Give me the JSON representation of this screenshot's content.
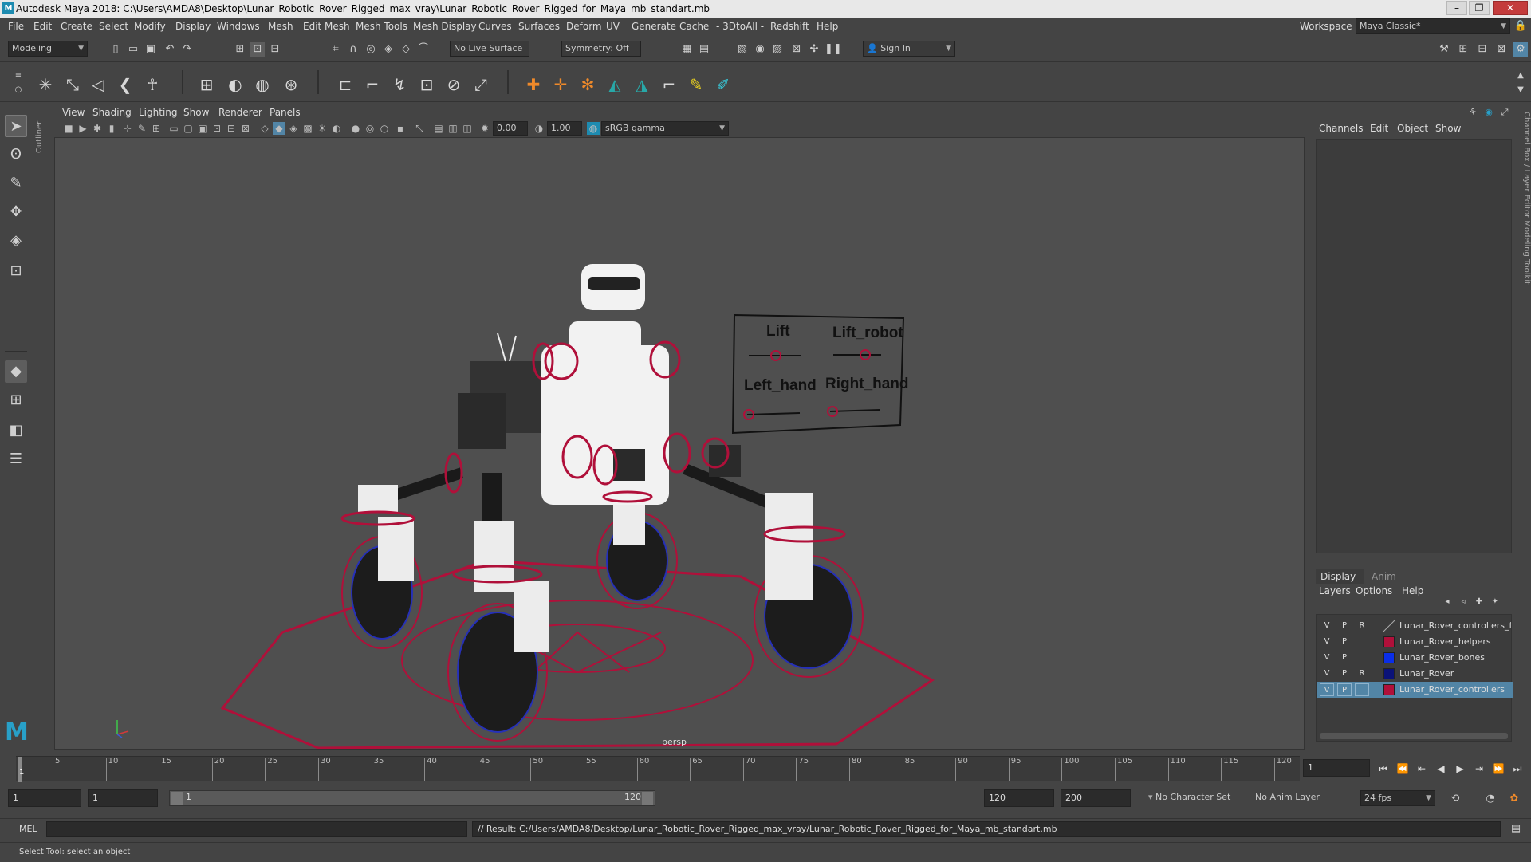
{
  "window": {
    "title": "Autodesk Maya 2018: C:\\Users\\AMDA8\\Desktop\\Lunar_Robotic_Rover_Rigged_max_vray\\Lunar_Robotic_Rover_Rigged_for_Maya_mb_standart.mb",
    "logo_letter": "M"
  },
  "menubar": {
    "items": [
      "File",
      "Edit",
      "Create",
      "Select",
      "Modify",
      "Display",
      "Windows",
      "Mesh",
      "Edit Mesh",
      "Mesh Tools",
      "Mesh Display",
      "Curves",
      "Surfaces",
      "Deform",
      "UV",
      "Generate",
      "Cache",
      "- 3DtoAll -",
      "Redshift",
      "Help"
    ],
    "workspace_label": "Workspace :",
    "workspace_value": "Maya Classic*"
  },
  "statusline": {
    "mode": "Modeling",
    "live_surface": "No Live Surface",
    "symmetry": "Symmetry: Off",
    "sign_in": "Sign In"
  },
  "outliner_tab": "Outliner",
  "panel": {
    "menus": [
      "View",
      "Shading",
      "Lighting",
      "Show",
      "Renderer",
      "Panels"
    ],
    "exposure": "0.00",
    "gamma": "1.00",
    "color_space": "sRGB gamma",
    "camera": "persp"
  },
  "viewport_hud": {
    "controllers": [
      {
        "label": "Lift"
      },
      {
        "label": "Lift_robot"
      },
      {
        "label": "Left_hand"
      },
      {
        "label": "Right_hand"
      }
    ]
  },
  "right_panel": {
    "channel_tabs": [
      "Channels",
      "Edit",
      "Object",
      "Show"
    ],
    "layer_tabs": [
      "Display",
      "Anim"
    ],
    "layer_menus": [
      "Layers",
      "Options",
      "Help"
    ],
    "side_tabs": "Channel Box / Layer Editor     Modeling Toolkit",
    "layers": [
      {
        "v": "V",
        "p": "P",
        "r": "R",
        "color": "",
        "name": "Lunar_Rover_controllers_freeze",
        "selected": false
      },
      {
        "v": "V",
        "p": "P",
        "r": "",
        "color": "#b0103a",
        "name": "Lunar_Rover_helpers",
        "selected": false
      },
      {
        "v": "V",
        "p": "P",
        "r": "",
        "color": "#0a2ee8",
        "name": "Lunar_Rover_bones",
        "selected": false
      },
      {
        "v": "V",
        "p": "P",
        "r": "R",
        "color": "#0a1278",
        "name": "Lunar_Rover",
        "selected": false
      },
      {
        "v": "V",
        "p": "P",
        "r": "",
        "color": "#b0103a",
        "name": "Lunar_Rover_controllers",
        "selected": true
      }
    ]
  },
  "timeline": {
    "labels": [
      "5",
      "10",
      "15",
      "20",
      "25",
      "30",
      "35",
      "40",
      "45",
      "50",
      "55",
      "60",
      "65",
      "70",
      "75",
      "80",
      "85",
      "90",
      "95",
      "100",
      "105",
      "110",
      "115",
      "120"
    ],
    "current_frame_label": "1",
    "current_frame_field": "1"
  },
  "range": {
    "start": "1",
    "playback_start": "1",
    "slider_start": "1",
    "slider_end": "120",
    "playback_end": "120",
    "end": "200",
    "character_set": "No Character Set",
    "anim_layer": "No Anim Layer",
    "fps": "24 fps"
  },
  "command": {
    "language": "MEL",
    "result": "// Result: C:/Users/AMDA8/Desktop/Lunar_Robotic_Rover_Rigged_max_vray/Lunar_Robotic_Rover_Rigged_for_Maya_mb_standart.mb"
  },
  "helpline": "Select Tool: select an object",
  "colors": {
    "controller_red": "#b0103a",
    "bone_blue": "#2630b8",
    "selection_blue": "#5285a6"
  }
}
